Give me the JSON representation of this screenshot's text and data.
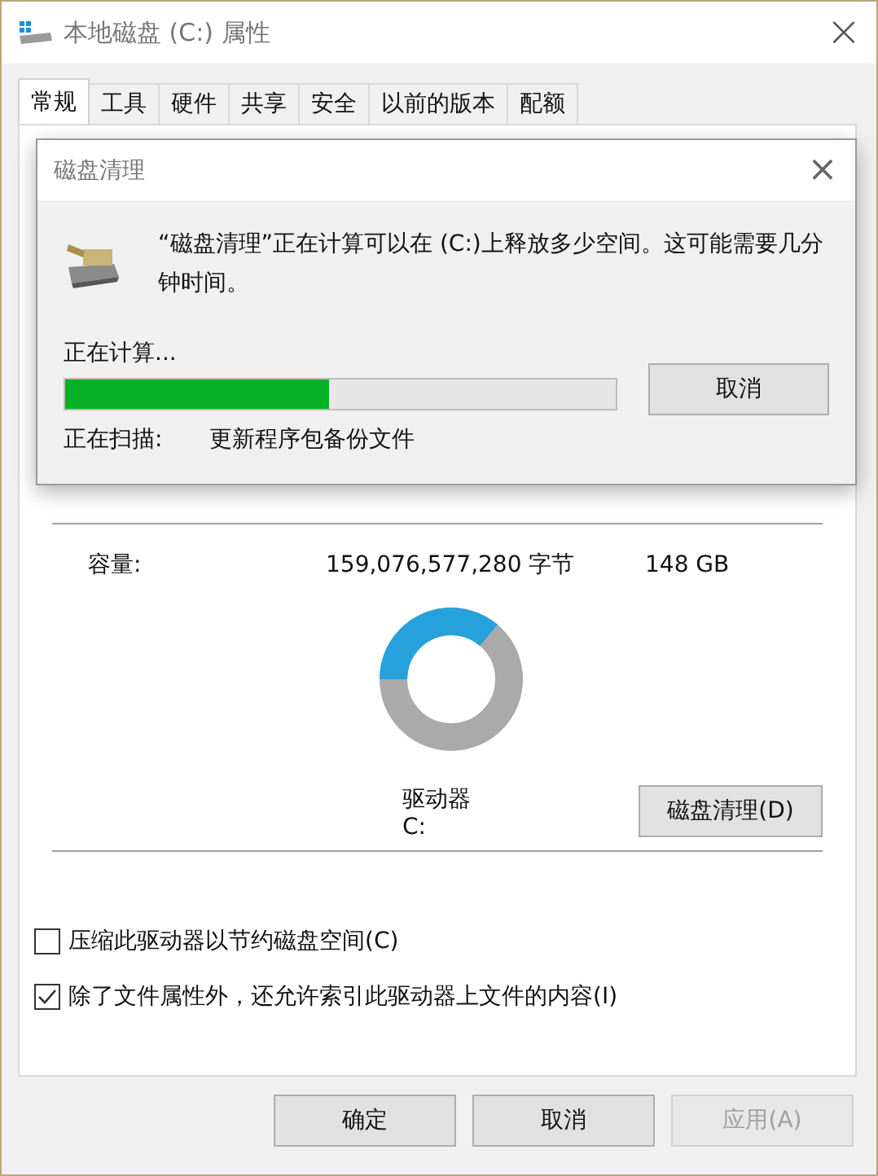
{
  "window": {
    "title": "本地磁盘 (C:) 属性",
    "close": "×"
  },
  "tabs": [
    {
      "label": "常规",
      "selected": true
    },
    {
      "label": "工具",
      "selected": false
    },
    {
      "label": "硬件",
      "selected": false
    },
    {
      "label": "共享",
      "selected": false
    },
    {
      "label": "安全",
      "selected": false
    },
    {
      "label": "以前的版本",
      "selected": false
    },
    {
      "label": "配额",
      "selected": false
    }
  ],
  "capacity": {
    "label": "容量:",
    "bytes": "159,076,577,280 字节",
    "size": "148 GB"
  },
  "drive_label": "驱动器 C:",
  "cleanup_button": "磁盘清理(D)",
  "options": [
    {
      "label": "压缩此驱动器以节约磁盘空间(C)",
      "checked": false
    },
    {
      "label": "除了文件属性外，还允许索引此驱动器上文件的内容(I)",
      "checked": true
    }
  ],
  "buttons": [
    {
      "label": "确定",
      "disabled": false
    },
    {
      "label": "取消",
      "disabled": false
    },
    {
      "label": "应用(A)",
      "disabled": true
    }
  ],
  "dialog": {
    "title": "磁盘清理",
    "close": "×",
    "message": "“磁盘清理”正在计算可以在 (C:)上释放多少空间。这可能需要几分钟时间。",
    "status": "正在计算...",
    "progress": {
      "level": 0.48
    },
    "cancel": "取消",
    "scan_label": "正在扫描:",
    "scan_item": "更新程序包备份文件"
  }
}
